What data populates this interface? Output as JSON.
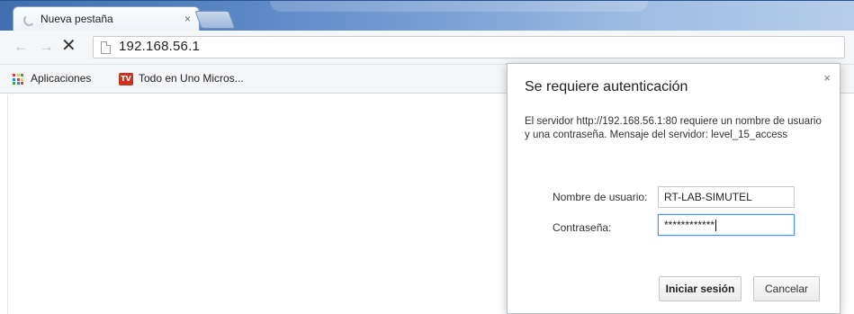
{
  "tab": {
    "title": "Nueva pestaña",
    "close": "×"
  },
  "toolbar": {
    "back": "←",
    "forward": "→",
    "stop": "✕",
    "url": "192.168.56.1"
  },
  "bookmarks": [
    {
      "label": "Aplicaciones"
    },
    {
      "label": "Todo en Uno Micros...",
      "icon_text": "TV"
    }
  ],
  "apps_icon_colors": [
    "#e53935",
    "#fbc02d",
    "#43a047",
    "#1e88e5",
    "#e53935",
    "#fbc02d",
    "#43a047",
    "#1e88e5",
    "#e53935"
  ],
  "dialog": {
    "title": "Se requiere autenticación",
    "close": "×",
    "message": "El servidor http://192.168.56.1:80 requiere un nombre de usuario y una contraseña. Mensaje del servidor: level_15_access",
    "username_label": "Nombre de usuario:",
    "username_value": "RT-LAB-SIMUTEL",
    "password_label": "Contraseña:",
    "password_mask": "************",
    "login_button": "Iniciar sesión",
    "cancel_button": "Cancelar"
  }
}
